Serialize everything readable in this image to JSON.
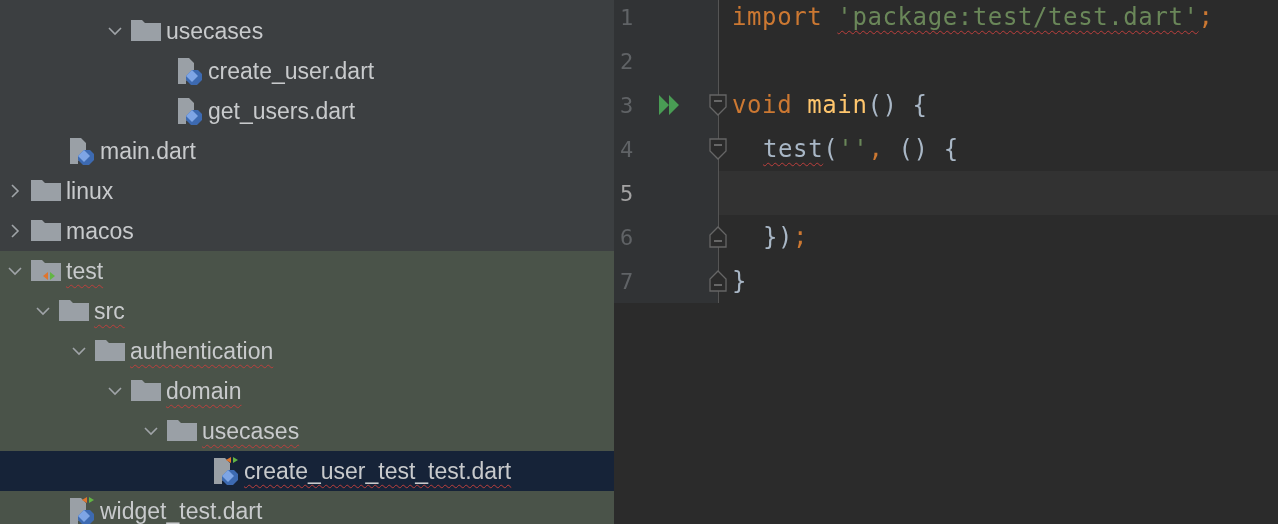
{
  "project_tree": [
    {
      "children": [
        {
          "children": [
            {
              "children": [
                {
                  "name": "usecases",
                  "kind": "folder",
                  "expanded": true,
                  "selected": false,
                  "misspelled": false,
                  "children": [
                    {
                      "name": "create_user.dart",
                      "kind": "dart_file",
                      "selected": false,
                      "misspelled": false
                    },
                    {
                      "name": "get_users.dart",
                      "kind": "dart_file",
                      "selected": false,
                      "misspelled": false
                    }
                  ]
                }
              ]
            }
          ]
        },
        {
          "name": "main.dart",
          "kind": "dart_file",
          "selected": false,
          "misspelled": false
        }
      ]
    },
    {
      "name": "linux",
      "kind": "folder",
      "expanded": false,
      "selected": false,
      "misspelled": false
    },
    {
      "name": "macos",
      "kind": "folder",
      "expanded": false,
      "selected": false,
      "misspelled": false
    },
    {
      "name": "test",
      "kind": "test_folder",
      "expanded": true,
      "selected": false,
      "misspelled": true,
      "children": [
        {
          "name": "src",
          "kind": "folder",
          "expanded": true,
          "selected": false,
          "misspelled": true,
          "children": [
            {
              "name": "authentication",
              "kind": "folder",
              "expanded": true,
              "selected": false,
              "misspelled": true,
              "children": [
                {
                  "name": "domain",
                  "kind": "folder",
                  "expanded": true,
                  "selected": false,
                  "misspelled": true,
                  "children": [
                    {
                      "name": "usecases",
                      "kind": "folder",
                      "expanded": true,
                      "selected": false,
                      "misspelled": true,
                      "children": [
                        {
                          "name": "create_user_test_test.dart",
                          "kind": "dart_test_file",
                          "selected": true,
                          "misspelled": true
                        }
                      ]
                    }
                  ]
                }
              ]
            }
          ]
        },
        {
          "name": "widget_test.dart",
          "kind": "dart_test_file",
          "selected": false,
          "misspelled": false
        }
      ]
    }
  ],
  "editor": {
    "lines": [
      {
        "number": "1",
        "current": false,
        "run": false,
        "fold_start": false,
        "fold_end": false,
        "indented": false,
        "tokens": [
          {
            "text": "import ",
            "kind": "keyword",
            "misspelled": false
          },
          {
            "text": "'package:test/test.dart'",
            "kind": "string",
            "misspelled": true
          },
          {
            "text": ";",
            "kind": "keyword",
            "misspelled": false
          }
        ]
      },
      {
        "number": "2",
        "current": false,
        "run": false,
        "fold_start": false,
        "fold_end": false
      },
      {
        "number": "3",
        "current": false,
        "run": true,
        "fold_start": true,
        "fold_end": false,
        "indented": false,
        "tokens": [
          {
            "text": "void ",
            "kind": "keyword",
            "misspelled": false
          },
          {
            "text": "main",
            "kind": "function",
            "misspelled": false
          },
          {
            "text": "() {",
            "kind": "plain",
            "misspelled": false
          }
        ]
      },
      {
        "number": "4",
        "current": false,
        "run": false,
        "fold_start": true,
        "fold_end": false,
        "indented": true,
        "tokens": [
          {
            "text": "test",
            "kind": "plain",
            "misspelled": true
          },
          {
            "text": "(",
            "kind": "plain",
            "misspelled": false
          },
          {
            "text": "''",
            "kind": "string",
            "misspelled": false
          },
          {
            "text": ",",
            "kind": "keyword",
            "misspelled": false
          },
          {
            "text": " () {",
            "kind": "plain",
            "misspelled": false
          }
        ]
      },
      {
        "number": "5",
        "current": true,
        "run": false,
        "fold_start": false,
        "fold_end": false
      },
      {
        "number": "6",
        "current": false,
        "run": false,
        "fold_start": false,
        "fold_end": true,
        "indented": true,
        "tokens": [
          {
            "text": "})",
            "kind": "plain",
            "misspelled": false
          },
          {
            "text": ";",
            "kind": "keyword",
            "misspelled": false
          }
        ]
      },
      {
        "number": "7",
        "current": false,
        "run": false,
        "fold_start": false,
        "fold_end": true,
        "indented": false,
        "tokens": [
          {
            "text": "}",
            "kind": "plain",
            "misspelled": false
          }
        ]
      }
    ]
  }
}
